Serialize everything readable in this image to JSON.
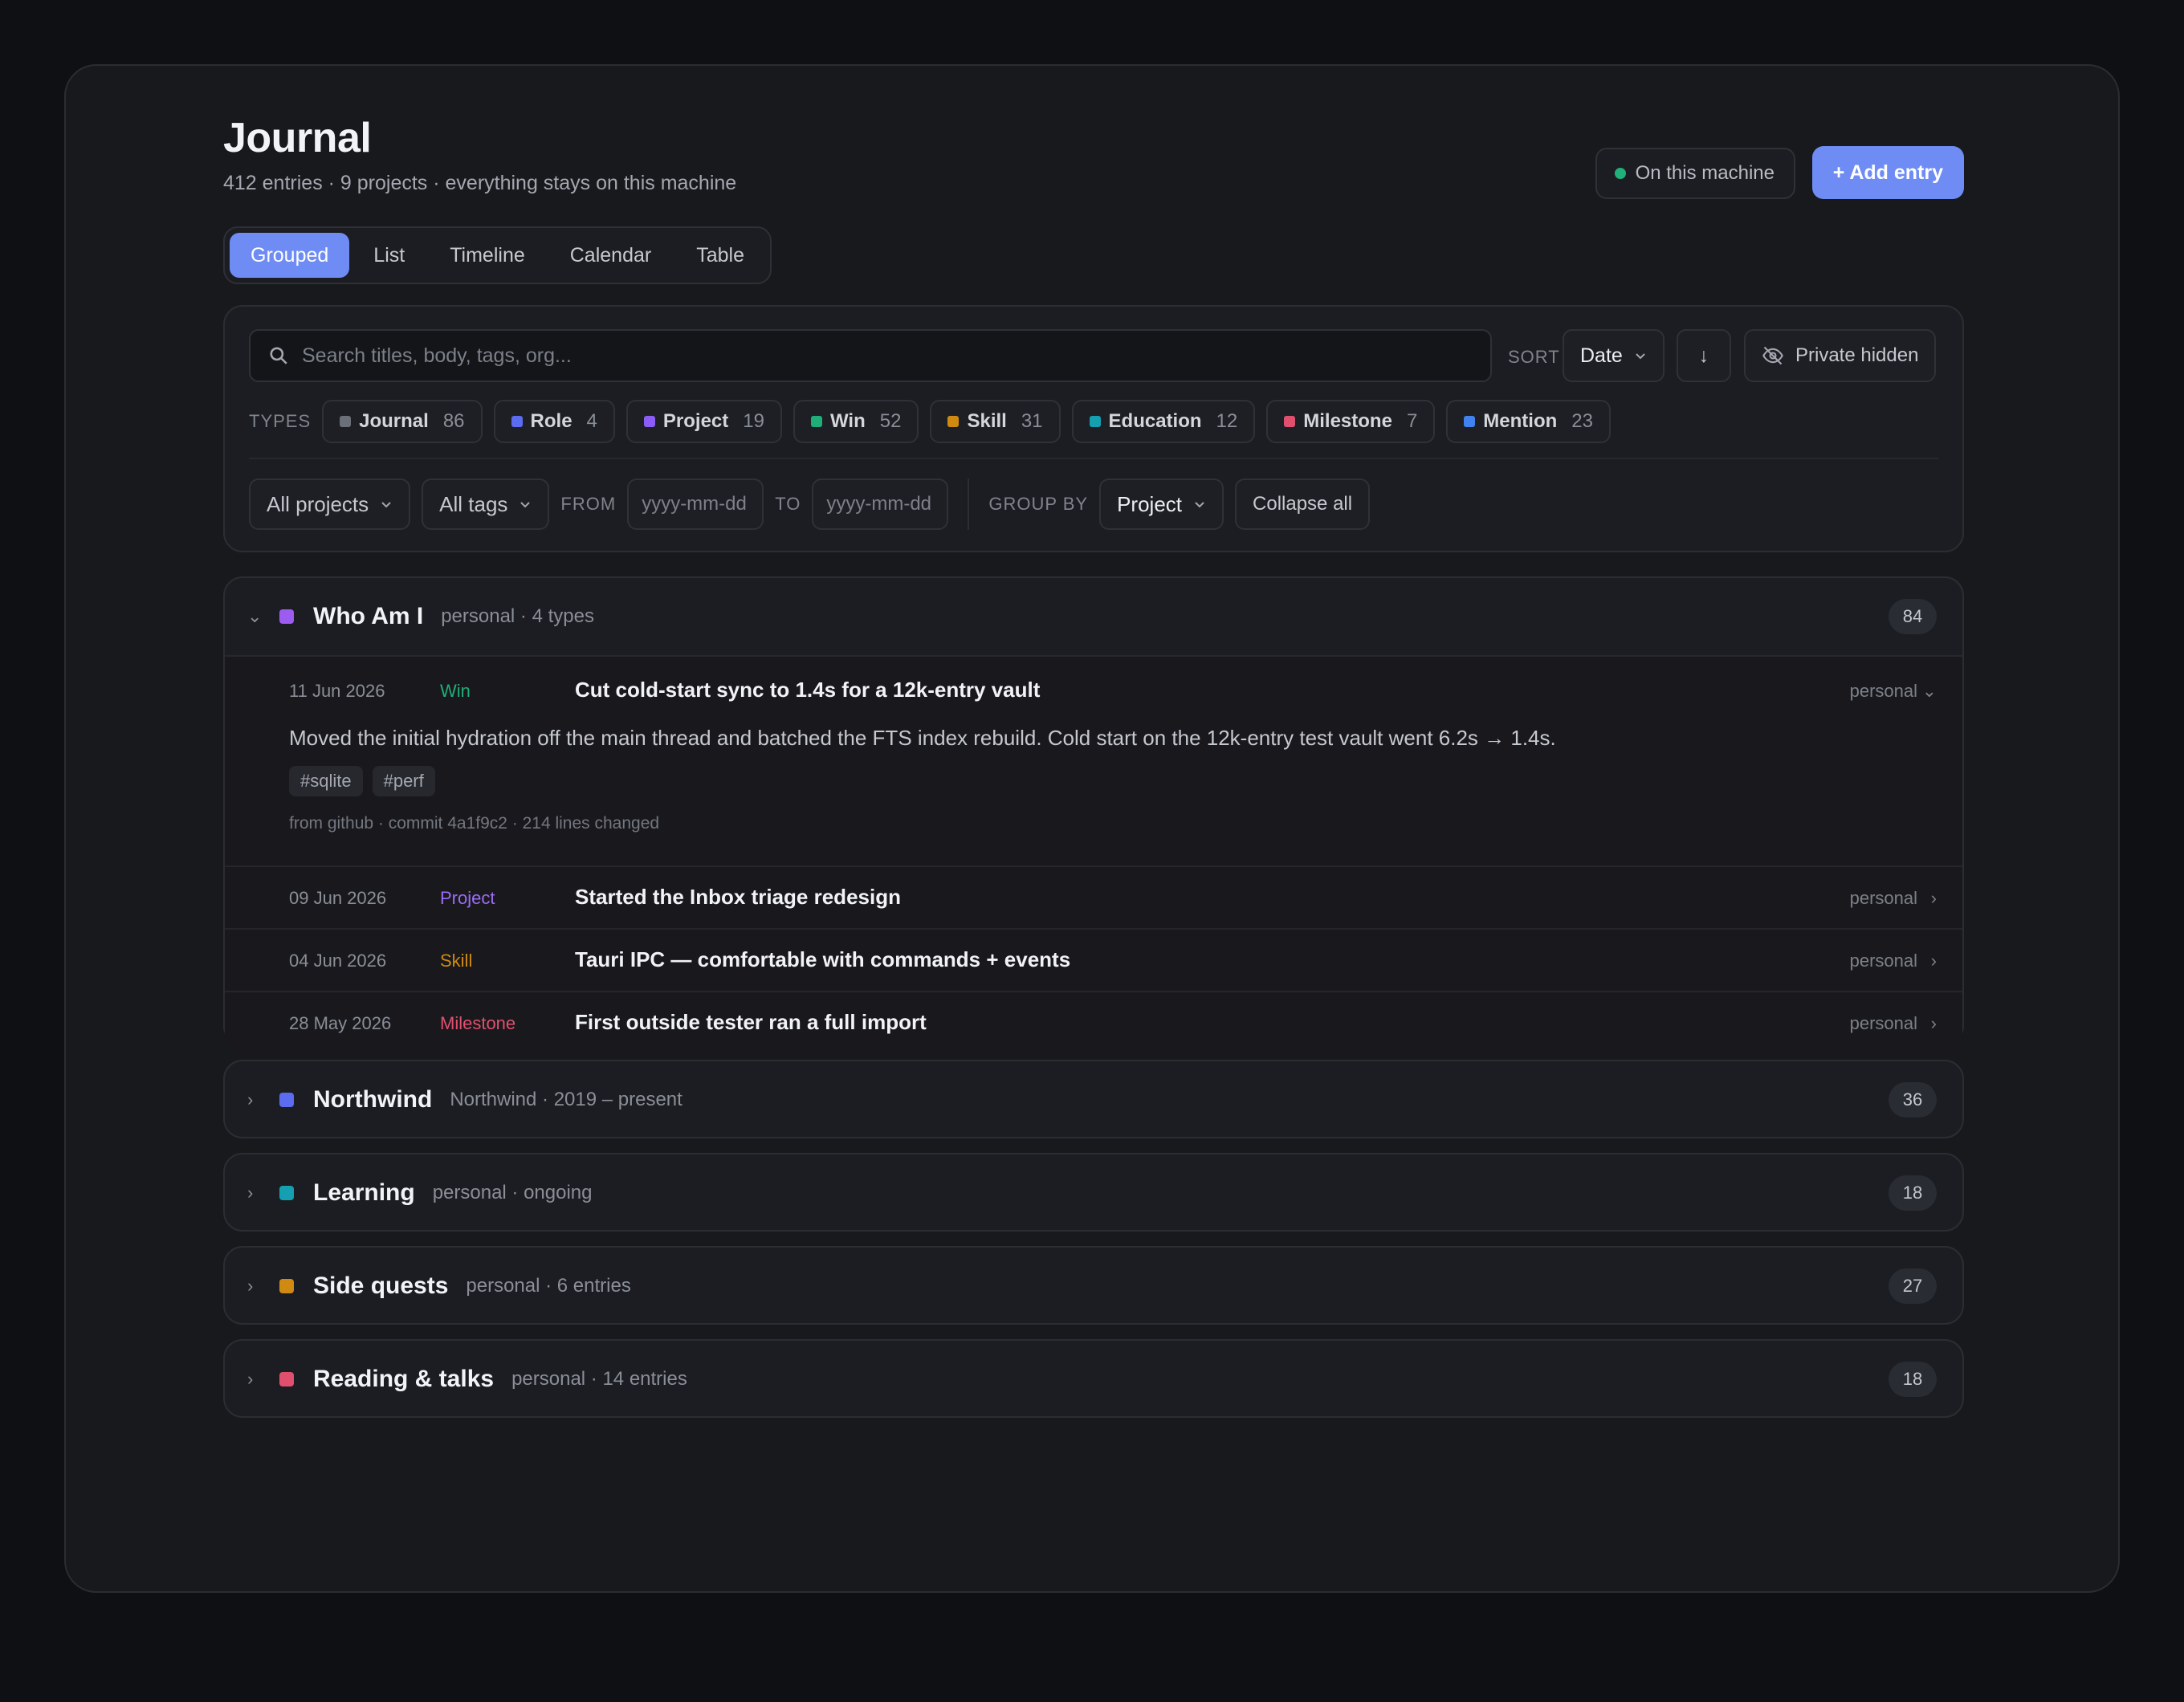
{
  "header": {
    "title": "Journal",
    "subtitle": "412 entries · 9 projects · everything stays on this machine",
    "machine_label": "On this machine",
    "add_label": "+ Add entry"
  },
  "tabs": [
    {
      "label": "Grouped",
      "active": true
    },
    {
      "label": "List"
    },
    {
      "label": "Timeline"
    },
    {
      "label": "Calendar"
    },
    {
      "label": "Table"
    }
  ],
  "filters": {
    "search_placeholder": "Search titles, body, tags, org...",
    "sort_label": "SORT",
    "sort_value": "Date",
    "sort_dir": "↓",
    "private_label": "Private hidden",
    "types_label": "TYPES",
    "types": [
      {
        "name": "Journal",
        "count": "86",
        "color": "#6b6f78"
      },
      {
        "name": "Role",
        "count": "4",
        "color": "#5b6cf0"
      },
      {
        "name": "Project",
        "count": "19",
        "color": "#8b5cf6"
      },
      {
        "name": "Win",
        "count": "52",
        "color": "#1fae78"
      },
      {
        "name": "Skill",
        "count": "31",
        "color": "#d08a12"
      },
      {
        "name": "Education",
        "count": "12",
        "color": "#14a0b0"
      },
      {
        "name": "Milestone",
        "count": "7",
        "color": "#e0506e"
      },
      {
        "name": "Mention",
        "count": "23",
        "color": "#3f82f0"
      }
    ],
    "projects_value": "All projects",
    "tags_value": "All tags",
    "from_label": "FROM",
    "from_placeholder": "yyyy-mm-dd",
    "to_label": "TO",
    "to_placeholder": "yyyy-mm-dd",
    "group_by_label": "GROUP BY",
    "group_by_value": "Project",
    "collapse_label": "Collapse all"
  },
  "groups": [
    {
      "name": "Who Am I",
      "meta": "personal · 4 types",
      "count": "84",
      "color": "#9d5cf0",
      "expanded": true,
      "entries": [
        {
          "date": "11 Jun 2026",
          "type": "Win",
          "type_color": "#1fae78",
          "title": "Cut cold-start sync to 1.4s for a 12k-entry vault",
          "privacy": "personal",
          "expanded": true,
          "body": "Moved the initial hydration off the main thread and batched the FTS index rebuild. Cold start on the 12k-entry test vault went 6.2s → 1.4s.",
          "tags": [
            "#sqlite",
            "#perf"
          ],
          "source": "from github · commit 4a1f9c2 · 214 lines changed"
        },
        {
          "date": "09 Jun 2026",
          "type": "Project",
          "type_color": "#9d6cf6",
          "title": "Started the Inbox triage redesign",
          "privacy": "personal"
        },
        {
          "date": "04 Jun 2026",
          "type": "Skill",
          "type_color": "#d08a12",
          "title": "Tauri IPC — comfortable with commands + events",
          "privacy": "personal"
        },
        {
          "date": "28 May 2026",
          "type": "Milestone",
          "type_color": "#e0506e",
          "title": "First outside tester ran a full import",
          "privacy": "personal"
        }
      ]
    },
    {
      "name": "Northwind",
      "meta": "Northwind · 2019 – present",
      "count": "36",
      "color": "#5b6cf0"
    },
    {
      "name": "Learning",
      "meta": "personal · ongoing",
      "count": "18",
      "color": "#14a0b0"
    },
    {
      "name": "Side quests",
      "meta": "personal · 6 entries",
      "count": "27",
      "color": "#d08a12"
    },
    {
      "name": "Reading & talks",
      "meta": "personal · 14 entries",
      "count": "18",
      "color": "#e0506e"
    }
  ]
}
